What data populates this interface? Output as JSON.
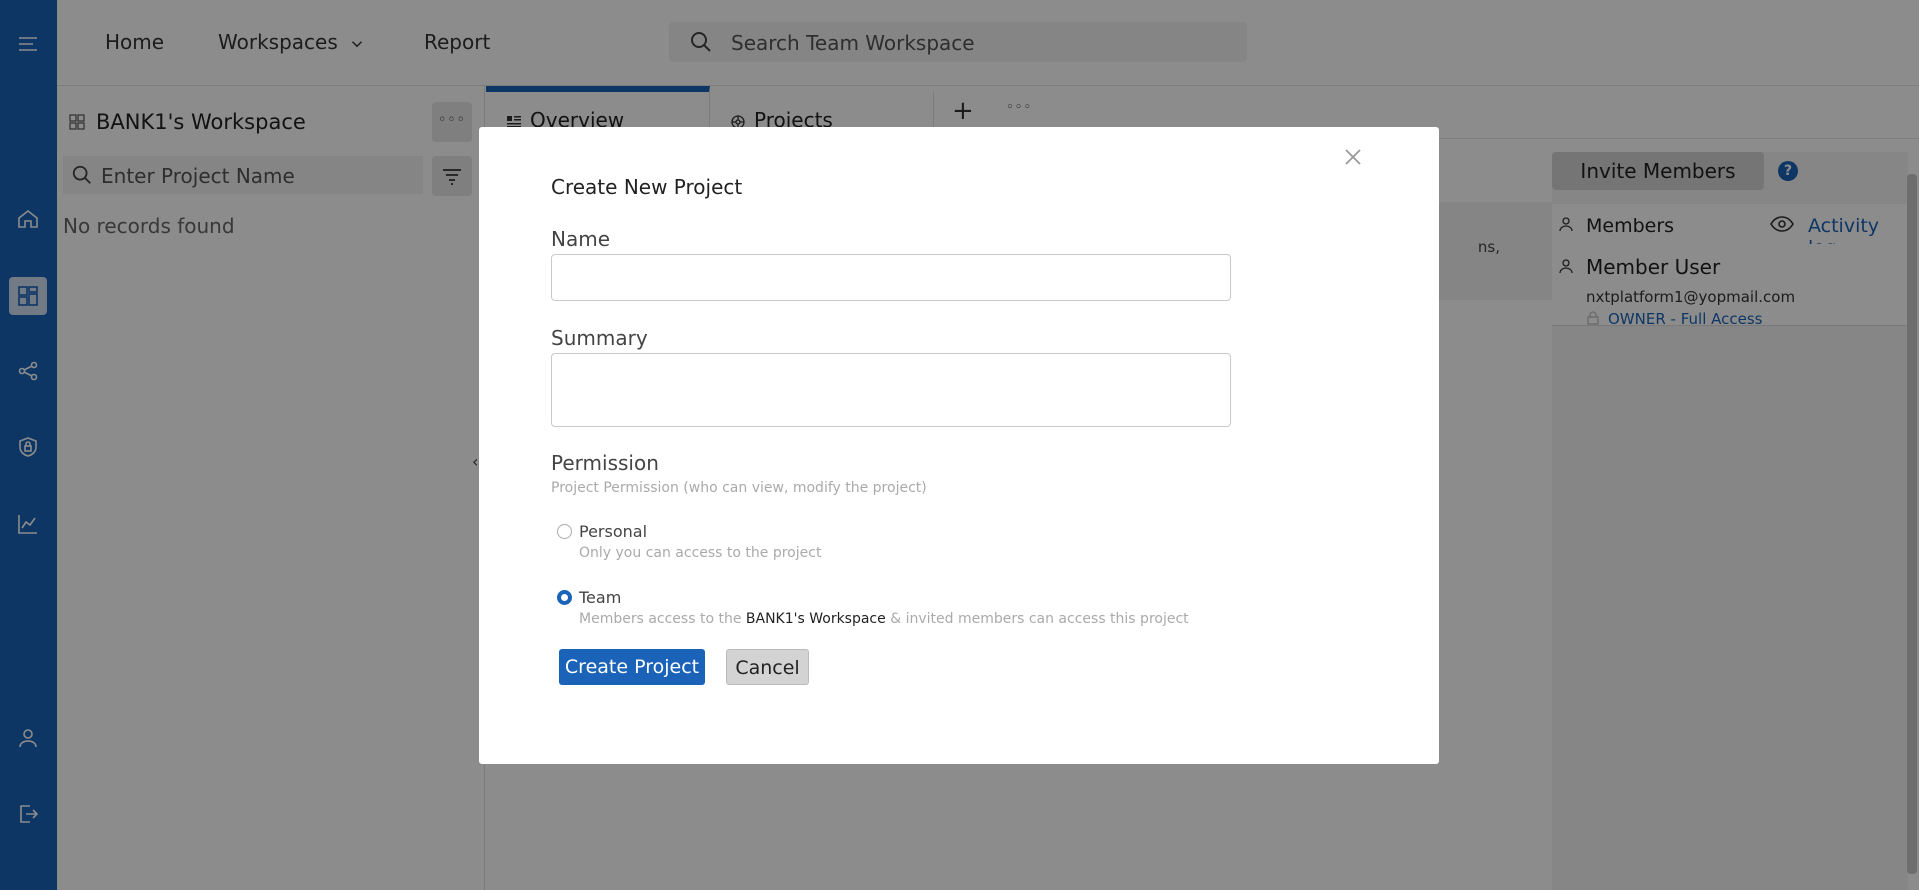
{
  "topnav": {
    "home": "Home",
    "workspaces": "Workspaces",
    "report": "Report",
    "search_placeholder": "Search Team Workspace"
  },
  "left_panel": {
    "workspace_title": "BANK1's Workspace",
    "project_search_placeholder": "Enter Project Name",
    "empty_text": "No records found"
  },
  "tabs": [
    {
      "label": "Overview",
      "active": true
    },
    {
      "label": "Projects",
      "active": false
    }
  ],
  "overview": {
    "card_text_fragment": "ns,"
  },
  "members_panel": {
    "invite_label": "Invite Members",
    "help_label": "?",
    "members_label": "Members",
    "activity_label": "Activity log",
    "member": {
      "name": "Member User",
      "email": "nxtplatform1@yopmail.com",
      "role": "OWNER - Full Access"
    }
  },
  "modal": {
    "title": "Create New Project",
    "name_label": "Name",
    "name_value": "",
    "summary_label": "Summary",
    "summary_value": "",
    "permission_label": "Permission",
    "permission_hint": "Project Permission (who can view, modify the project)",
    "options": [
      {
        "label": "Personal",
        "desc": "Only you can access to the project",
        "checked": false
      },
      {
        "label": "Team",
        "desc_prefix": "Members access to the ",
        "desc_highlight": "BANK1's Workspace",
        "desc_suffix": " & invited members can access this project",
        "checked": true
      }
    ],
    "create_label": "Create Project",
    "cancel_label": "Cancel"
  },
  "colors": {
    "brand": "#1a63b8",
    "overlay": "rgba(0,0,0,0.45)"
  }
}
